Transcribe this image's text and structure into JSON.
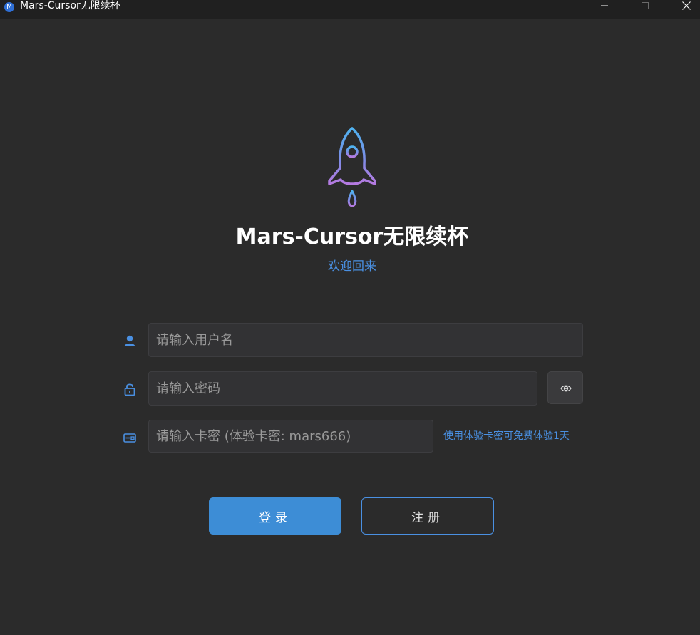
{
  "window": {
    "title": "Mars-Cursor无限续杯",
    "app_icon_letter": "M",
    "icons": {
      "minimize": "minimize-icon",
      "maximize": "maximize-icon",
      "close": "close-icon"
    }
  },
  "brand": {
    "logo_icon": "rocket-icon",
    "title": "Mars-Cursor无限续杯",
    "subtitle": "欢迎回来",
    "accent_color": "#4a90e2"
  },
  "form": {
    "username": {
      "icon": "user-icon",
      "placeholder": "请输入用户名",
      "value": ""
    },
    "password": {
      "icon": "lock-icon",
      "placeholder": "请输入密码",
      "value": "",
      "toggle_icon": "eye-icon"
    },
    "card": {
      "icon": "card-icon",
      "placeholder": "请输入卡密 (体验卡密: mars666)",
      "value": "",
      "trial_link": "使用体验卡密可免费体验1天"
    }
  },
  "actions": {
    "login_label": "登录",
    "register_label": "注册",
    "primary_color": "#3d8dd6"
  }
}
